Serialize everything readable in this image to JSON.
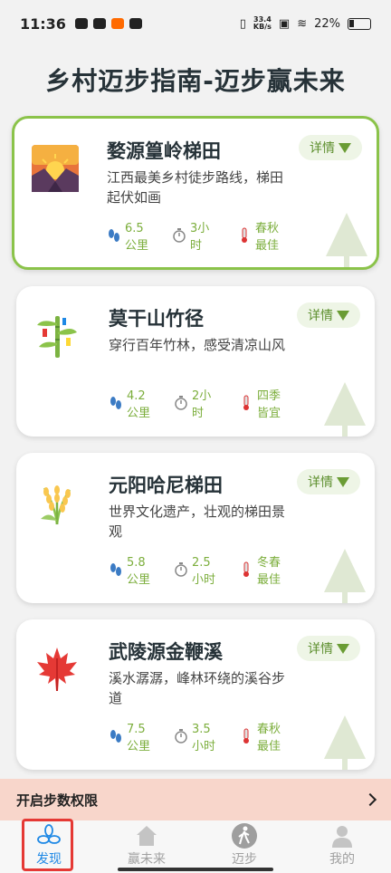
{
  "status": {
    "time": "11:36",
    "speed_value": "33.4",
    "speed_unit": "KB/s",
    "battery": "22%"
  },
  "page": {
    "title": "乡村迈步指南-迈步赢未来"
  },
  "routes": [
    {
      "title": "婺源篁岭梯田",
      "desc": "江西最美乡村徒步路线，梯田起伏如画",
      "distance": "6.5公里",
      "duration": "3小时",
      "season": "春秋最佳",
      "detail": "详情",
      "icon": "sunrise-icon"
    },
    {
      "title": "莫干山竹径",
      "desc": "穿行百年竹林，感受清凉山风",
      "distance": "4.2公里",
      "duration": "2小时",
      "season": "四季皆宜",
      "detail": "详情",
      "icon": "bamboo-icon"
    },
    {
      "title": "元阳哈尼梯田",
      "desc": "世界文化遗产，壮观的梯田景观",
      "distance": "5.8 公里",
      "duration": "2.5 小时",
      "season": "冬春最佳",
      "detail": "详情",
      "icon": "rice-icon"
    },
    {
      "title": "武陵源金鞭溪",
      "desc": "溪水潺潺，峰林环绕的溪谷步道",
      "distance": "7.5 公里",
      "duration": "3.5 小时",
      "season": "春秋最佳",
      "detail": "详情",
      "icon": "maple-leaf-icon"
    }
  ],
  "permission": {
    "label": "开启步数权限"
  },
  "nav": [
    {
      "label": "发现",
      "icon": "discover-icon",
      "active": true
    },
    {
      "label": "赢未来",
      "icon": "home-icon",
      "active": false
    },
    {
      "label": "迈步",
      "icon": "walk-icon",
      "active": false
    },
    {
      "label": "我的",
      "icon": "profile-icon",
      "active": false
    }
  ],
  "colors": {
    "accent_green": "#7cae3c",
    "active_nav": "#1e88e5",
    "permission_bg": "#f8d6cb"
  }
}
